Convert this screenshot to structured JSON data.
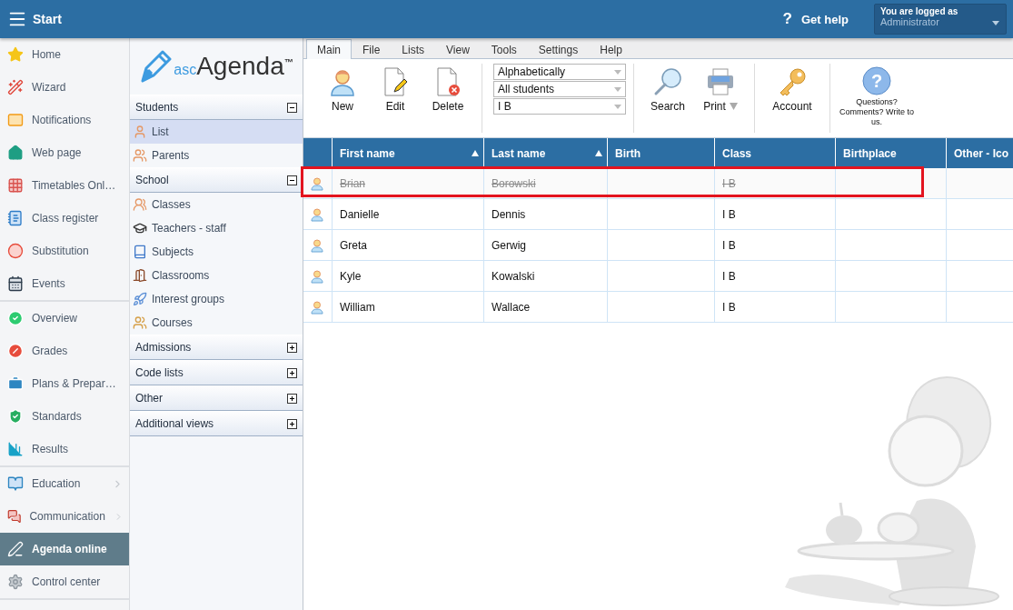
{
  "topbar": {
    "title": "Start",
    "help_icon": "?",
    "help": "Get help",
    "login": {
      "caption": "You are logged as",
      "user": "Administrator"
    }
  },
  "nav": {
    "groups": [
      [
        {
          "label": "Home",
          "selected": false,
          "has_submenu": false
        },
        {
          "label": "Wizard",
          "selected": false,
          "has_submenu": false
        },
        {
          "label": "Notifications",
          "selected": false,
          "has_submenu": false
        },
        {
          "label": "Web page",
          "selected": false,
          "has_submenu": false
        },
        {
          "label": "Timetables Onl…",
          "selected": false,
          "has_submenu": false
        },
        {
          "label": "Class register",
          "selected": false,
          "has_submenu": false
        },
        {
          "label": "Substitution",
          "selected": false,
          "has_submenu": false
        },
        {
          "label": "Events",
          "selected": false,
          "has_submenu": false
        }
      ],
      [
        {
          "label": "Overview",
          "selected": false,
          "has_submenu": false
        },
        {
          "label": "Grades",
          "selected": false,
          "has_submenu": false
        },
        {
          "label": "Plans & Prepar…",
          "selected": false,
          "has_submenu": false
        },
        {
          "label": "Standards",
          "selected": false,
          "has_submenu": false
        },
        {
          "label": "Results",
          "selected": false,
          "has_submenu": false
        }
      ],
      [
        {
          "label": "Education",
          "selected": false,
          "has_submenu": true
        },
        {
          "label": "Communication",
          "selected": false,
          "has_submenu": true
        },
        {
          "label": "Agenda online",
          "selected": true,
          "has_submenu": false
        },
        {
          "label": "Control center",
          "selected": false,
          "has_submenu": false
        }
      ]
    ]
  },
  "logo": {
    "prefix": "asc",
    "name": "Agenda",
    "mark": "™"
  },
  "tree": [
    {
      "title": "Students",
      "expanded": true,
      "items": [
        {
          "label": "List",
          "selected": true
        },
        {
          "label": "Parents",
          "selected": false
        }
      ]
    },
    {
      "title": "School",
      "expanded": true,
      "items": [
        {
          "label": "Classes",
          "selected": false
        },
        {
          "label": "Teachers - staff",
          "selected": false
        },
        {
          "label": "Subjects",
          "selected": false
        },
        {
          "label": "Classrooms",
          "selected": false
        },
        {
          "label": "Interest groups",
          "selected": false
        },
        {
          "label": "Courses",
          "selected": false
        }
      ]
    },
    {
      "title": "Admissions",
      "expanded": false
    },
    {
      "title": "Code lists",
      "expanded": false
    },
    {
      "title": "Other",
      "expanded": false
    },
    {
      "title": "Additional views",
      "expanded": false
    }
  ],
  "tabs": [
    {
      "label": "Main",
      "selected": true
    },
    {
      "label": "File",
      "selected": false
    },
    {
      "label": "Lists",
      "selected": false
    },
    {
      "label": "View",
      "selected": false
    },
    {
      "label": "Tools",
      "selected": false
    },
    {
      "label": "Settings",
      "selected": false
    },
    {
      "label": "Help",
      "selected": false
    }
  ],
  "ribbon": {
    "actions": [
      {
        "label": "New"
      },
      {
        "label": "Edit"
      },
      {
        "label": "Delete"
      }
    ],
    "selects": [
      {
        "value": "Alphabetically"
      },
      {
        "value": "All students"
      },
      {
        "value": "I B"
      }
    ],
    "tools": [
      {
        "label": "Search",
        "has_dropdown": false
      },
      {
        "label": "Print",
        "has_dropdown": true
      }
    ],
    "account": "Account",
    "feedback_icon": "?",
    "feedback": "Questions? Comments? Write to us."
  },
  "table": {
    "columns": [
      {
        "label": "First name",
        "sorted": true
      },
      {
        "label": "Last name",
        "sorted": true
      },
      {
        "label": "Birth",
        "sorted": false
      },
      {
        "label": "Class",
        "sorted": false
      },
      {
        "label": "Birthplace",
        "sorted": false
      },
      {
        "label": "Other - Ico",
        "sorted": false
      }
    ],
    "rows": [
      {
        "cells": [
          "Brian",
          "Borowski",
          "",
          "I B",
          "",
          ""
        ],
        "deleted": true,
        "marked": true
      },
      {
        "cells": [
          "Danielle",
          "Dennis",
          "",
          "I B",
          "",
          ""
        ],
        "deleted": false,
        "marked": false
      },
      {
        "cells": [
          "Greta",
          "Gerwig",
          "",
          "I B",
          "",
          ""
        ],
        "deleted": false,
        "marked": false
      },
      {
        "cells": [
          "Kyle",
          "Kowalski",
          "",
          "I B",
          "",
          ""
        ],
        "deleted": false,
        "marked": false
      },
      {
        "cells": [
          "William",
          "Wallace",
          "",
          "I B",
          "",
          ""
        ],
        "deleted": false,
        "marked": false
      }
    ]
  }
}
